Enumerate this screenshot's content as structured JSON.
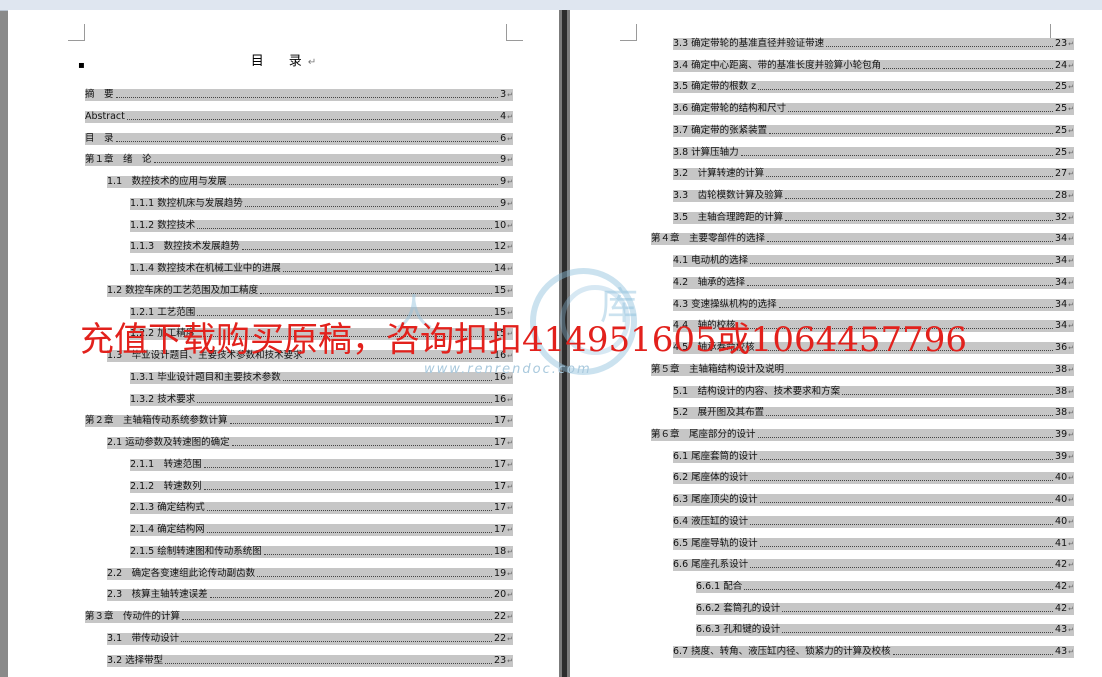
{
  "title": "目　录",
  "left_entries": [
    {
      "text": "摘　要",
      "page": "3",
      "level": 0
    },
    {
      "text": "Abstract",
      "page": "4",
      "level": 0
    },
    {
      "text": "目　录",
      "page": "6",
      "level": 0
    },
    {
      "text": "第１章　绪　论",
      "page": "9",
      "level": 0
    },
    {
      "text": "1.1　数控技术的应用与发展",
      "page": "9",
      "level": 1
    },
    {
      "text": "1.1.1 数控机床与发展趋势",
      "page": "9",
      "level": 2
    },
    {
      "text": "1.1.2 数控技术",
      "page": "10",
      "level": 2
    },
    {
      "text": "1.1.3　数控技术发展趋势",
      "page": "12",
      "level": 2
    },
    {
      "text": "1.1.4 数控技术在机械工业中的进展",
      "page": "14",
      "level": 2
    },
    {
      "text": "1.2 数控车床的工艺范围及加工精度",
      "page": "15",
      "level": 1
    },
    {
      "text": "1.2.1 工艺范围",
      "page": "15",
      "level": 2
    },
    {
      "text": "1.2.2 加工精度",
      "page": "15",
      "level": 2
    },
    {
      "text": "1.3　毕业设计题目、主要技术参数和技术要求",
      "page": "16",
      "level": 1
    },
    {
      "text": "1.3.1 毕业设计题目和主要技术参数",
      "page": "16",
      "level": 2
    },
    {
      "text": "1.3.2 技术要求",
      "page": "16",
      "level": 2
    },
    {
      "text": "第２章　主轴箱传动系统参数计算",
      "page": "17",
      "level": 0
    },
    {
      "text": "2.1 运动参数及转速图的确定",
      "page": "17",
      "level": 1
    },
    {
      "text": "2.1.1　转速范围",
      "page": "17",
      "level": 2
    },
    {
      "text": "2.1.2　转速数列",
      "page": "17",
      "level": 2
    },
    {
      "text": "2.1.3 确定结构式",
      "page": "17",
      "level": 2
    },
    {
      "text": "2.1.4 确定结构网",
      "page": "17",
      "level": 2
    },
    {
      "text": "2.1.5 绘制转速图和传动系统图",
      "page": "18",
      "level": 2
    },
    {
      "text": "2.2　确定各变速组此论传动副齿数",
      "page": "19",
      "level": 1
    },
    {
      "text": "2.3　核算主轴转速误差",
      "page": "20",
      "level": 1
    },
    {
      "text": "第３章　传动件的计算",
      "page": "22",
      "level": 0
    },
    {
      "text": "3.1　带传动设计",
      "page": "22",
      "level": 1
    },
    {
      "text": "3.2 选择带型",
      "page": "23",
      "level": 1
    }
  ],
  "right_entries": [
    {
      "text": "3.3 确定带轮的基准直径并验证带速",
      "page": "23",
      "level": 1
    },
    {
      "text": "3.4 确定中心距离、带的基准长度并验算小轮包角",
      "page": "24",
      "level": 1
    },
    {
      "text": "3.5 确定带的根数 z",
      "page": "25",
      "level": 1
    },
    {
      "text": "3.6 确定带轮的结构和尺寸",
      "page": "25",
      "level": 1
    },
    {
      "text": "3.7 确定带的张紧装置",
      "page": "25",
      "level": 1
    },
    {
      "text": "3.8 计算压轴力",
      "page": "25",
      "level": 1
    },
    {
      "text": "3.2　计算转速的计算",
      "page": "27",
      "level": 1
    },
    {
      "text": "3.3　齿轮模数计算及验算",
      "page": "28",
      "level": 1
    },
    {
      "text": "3.5　主轴合理跨距的计算",
      "page": "32",
      "level": 1
    },
    {
      "text": "第４章　主要零部件的选择",
      "page": "34",
      "level": 0
    },
    {
      "text": "4.1 电动机的选择",
      "page": "34",
      "level": 1
    },
    {
      "text": "4.2　轴承的选择",
      "page": "34",
      "level": 1
    },
    {
      "text": "4.3 变速操纵机构的选择",
      "page": "34",
      "level": 1
    },
    {
      "text": "4.4　轴的校核",
      "page": "34",
      "level": 1
    },
    {
      "text": "4.5　轴承寿命校核",
      "page": "36",
      "level": 1
    },
    {
      "text": "第５章　主轴箱结构设计及说明",
      "page": "38",
      "level": 0
    },
    {
      "text": "5.1　结构设计的内容、技术要求和方案",
      "page": "38",
      "level": 1
    },
    {
      "text": "5.2　展开图及其布置",
      "page": "38",
      "level": 1
    },
    {
      "text": "第６章　尾座部分的设计",
      "page": "39",
      "level": 0
    },
    {
      "text": "6.1 尾座套筒的设计",
      "page": "39",
      "level": 1
    },
    {
      "text": "6.2 尾座体的设计",
      "page": "40",
      "level": 1
    },
    {
      "text": "6.3 尾座顶尖的设计",
      "page": "40",
      "level": 1
    },
    {
      "text": "6.4 液压缸的设计",
      "page": "40",
      "level": 1
    },
    {
      "text": "6.5 尾座导轨的设计",
      "page": "41",
      "level": 1
    },
    {
      "text": "6.6 尾座孔系设计",
      "page": "42",
      "level": 1
    },
    {
      "text": "6.6.1 配合",
      "page": "42",
      "level": 2
    },
    {
      "text": "6.6.2 套筒孔的设计",
      "page": "42",
      "level": 2
    },
    {
      "text": "6.6.3 孔和键的设计",
      "page": "43",
      "level": 2
    },
    {
      "text": "6.7 挠度、转角、液压缸内径、锁紧力的计算及校核",
      "page": "43",
      "level": 1
    }
  ],
  "watermark": {
    "text": "充值下载购买原稿，咨询扣扣414951605或1064457796",
    "url": "www.renrendoc.com",
    "color": "#e2211c"
  }
}
